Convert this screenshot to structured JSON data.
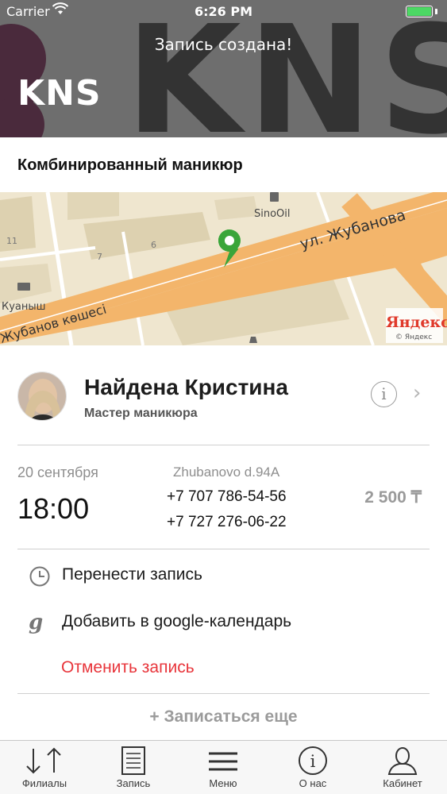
{
  "status_bar": {
    "carrier": "Carrier",
    "time": "6:26 PM"
  },
  "header": {
    "message": "Запись создана!",
    "brand": "KNS",
    "background_letters": "KNS"
  },
  "service": {
    "title": "Комбинированный маникюр"
  },
  "map": {
    "labels": {
      "street_main": "ул. Жубанова",
      "street_lower": "Жубанов көшесі",
      "poi_gas": "SinoOil",
      "poi_hotel": "Куаныш",
      "building_11": "11",
      "building_7": "7",
      "building_6": "6",
      "provider": "Яндекс",
      "provider_sub": "© Яндекс"
    },
    "pin_color": "#3aa53a",
    "road_color": "#f3b56b",
    "ground_color": "#efe6cf"
  },
  "master": {
    "name": "Найдена Кристина",
    "role": "Мастер маникюра",
    "info_icon": "info-icon",
    "chevron_icon": "chevron-right-icon"
  },
  "appointment": {
    "date": "20 сентября",
    "time": "18:00",
    "address": "Zhubanovo d.94A",
    "phones": [
      "+7 707 786-54-56",
      "+7 727 276-06-22"
    ],
    "price": "2 500 ₸"
  },
  "actions": {
    "reschedule": "Перенести запись",
    "google_calendar": "Добавить в google-календарь",
    "google_icon_glyph": "g",
    "cancel": "Отменить запись",
    "book_more": "+ Записаться еще"
  },
  "tabs": [
    {
      "label": "Филиалы",
      "icon": "sort-arrows-icon"
    },
    {
      "label": "Запись",
      "icon": "document-icon"
    },
    {
      "label": "Меню",
      "icon": "menu-icon"
    },
    {
      "label": "О нас",
      "icon": "info-icon"
    },
    {
      "label": "Кабинет",
      "icon": "user-icon"
    }
  ],
  "colors": {
    "accent_red": "#e8353b",
    "header_bg": "#6e6e6e",
    "brand_dark": "#4a2a3c"
  }
}
